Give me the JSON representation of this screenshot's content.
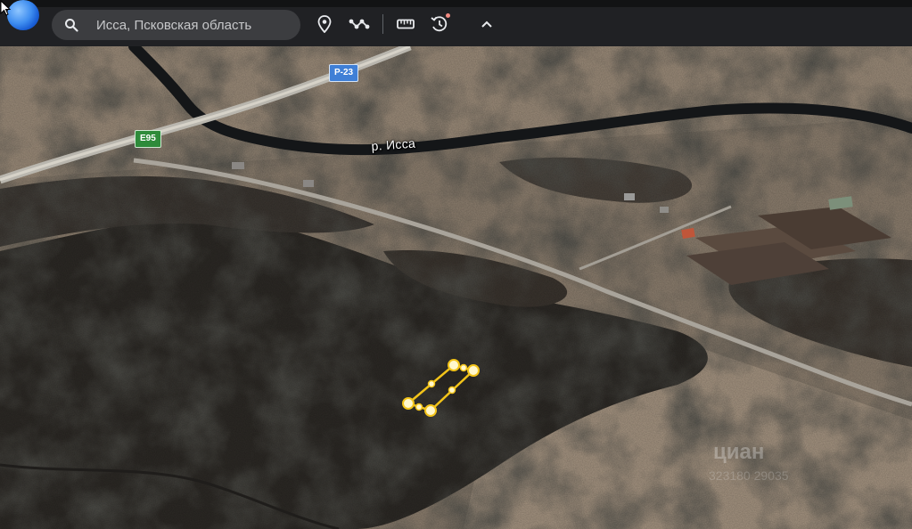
{
  "toolbar": {
    "search": {
      "value": "",
      "placeholder": "Исса, Псковская область"
    },
    "icons": [
      "earth-logo",
      "search-icon",
      "location-pin-icon",
      "path-icon",
      "ruler-icon",
      "history-icon",
      "chevron-up-icon"
    ]
  },
  "map": {
    "road_shields": [
      {
        "id": "e95",
        "label": "E95",
        "color": "#2e8b3a"
      },
      {
        "id": "p23",
        "label": "Р-23",
        "color": "#3f7fd6"
      }
    ],
    "river_label": "р. Исса",
    "watermark": "циан",
    "watermark_id": "323180 29035",
    "polygon_color": "#f2c319"
  }
}
